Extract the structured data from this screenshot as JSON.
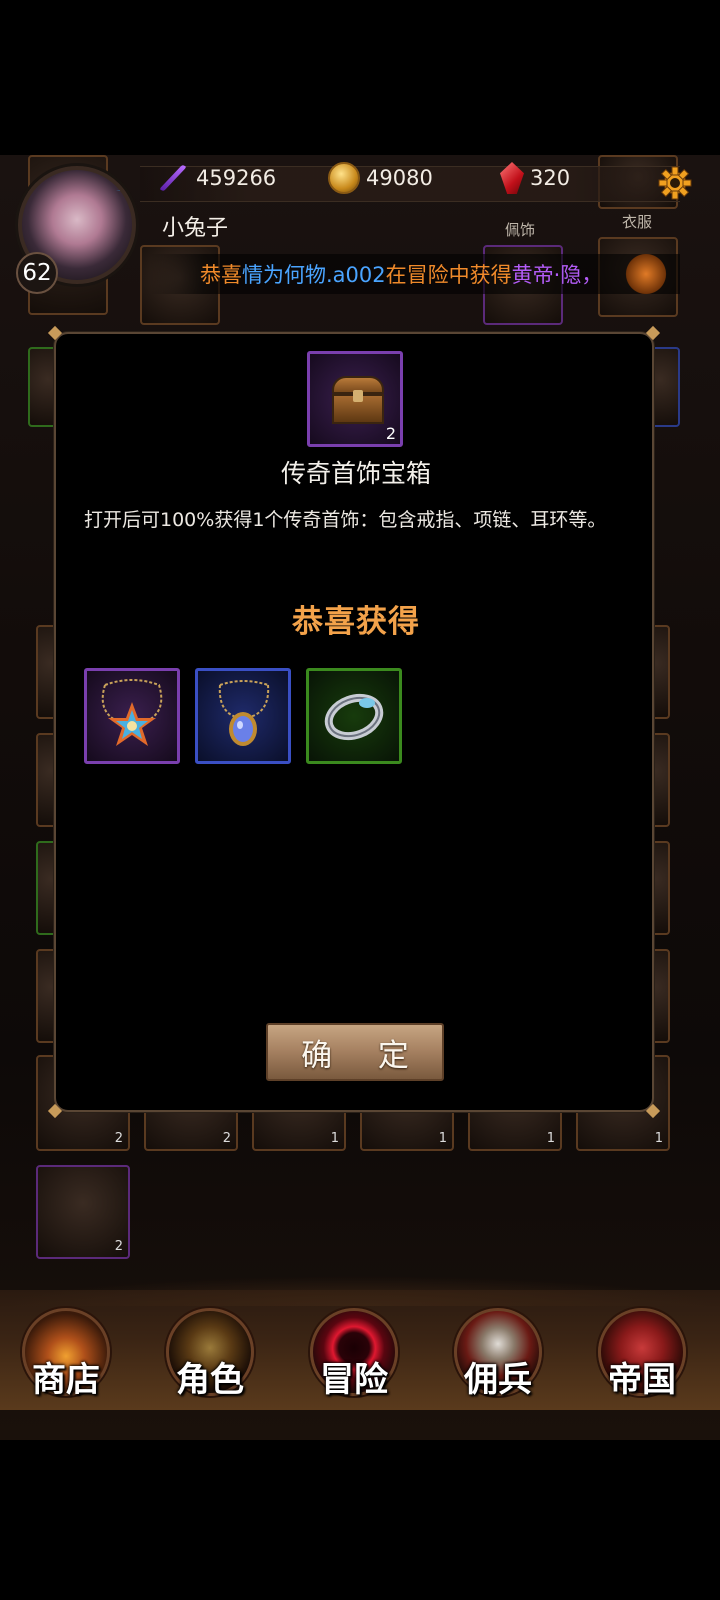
{
  "hud": {
    "energy": "459266",
    "gold": "49080",
    "gems": "320",
    "player_name": "小兔子",
    "level": "62",
    "ticker": {
      "part1": "恭喜",
      "part2": "情为何物.a002",
      "part3": "在冒险中获得",
      "part4": "黄帝·隐，"
    }
  },
  "background_labels": {
    "accessory": "佩饰",
    "clothes": "衣服"
  },
  "background_counts": [
    "2",
    "2",
    "1",
    "1",
    "1",
    "1",
    "2"
  ],
  "modal": {
    "chest_count": "2",
    "item_name": "传奇首饰宝箱",
    "description": "打开后可100%获得1个传奇首饰：包含戒指、项链、耳环等。",
    "congrats_title": "恭喜获得",
    "rewards": [
      {
        "icon": "star-pendant-necklace",
        "rarity": "purple"
      },
      {
        "icon": "sapphire-amulet-necklace",
        "rarity": "blue"
      },
      {
        "icon": "silver-ring",
        "rarity": "green"
      }
    ],
    "confirm_label": "确 定"
  },
  "nav": {
    "shop": "商店",
    "character": "角色",
    "adventure": "冒险",
    "mercenary": "佣兵",
    "empire": "帝国"
  }
}
